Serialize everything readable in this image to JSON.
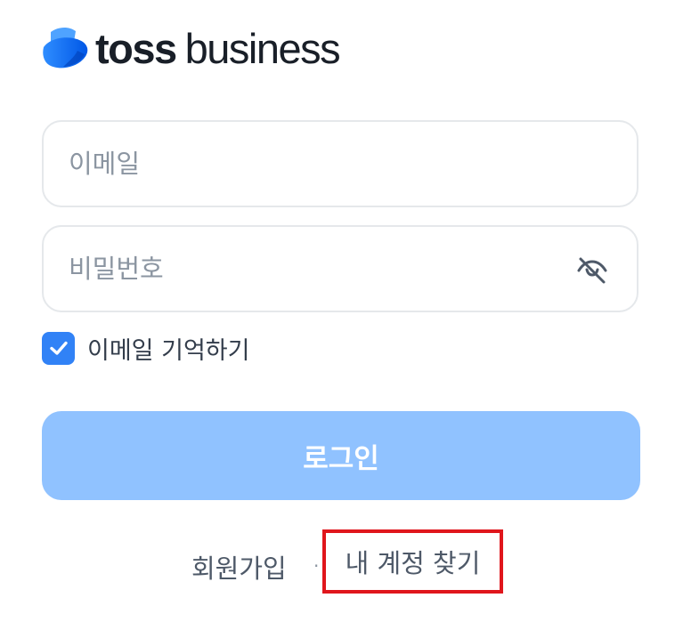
{
  "brand": {
    "logo_bold": "toss",
    "logo_light": "business"
  },
  "form": {
    "email": {
      "placeholder": "이메일",
      "value": ""
    },
    "password": {
      "placeholder": "비밀번호",
      "value": ""
    },
    "password_toggle_icon": "eye-off-icon",
    "remember": {
      "label": "이메일 기억하기",
      "checked": true
    },
    "login_label": "로그인"
  },
  "links": {
    "signup": "회원가입",
    "separator": "·",
    "find_account": "내 계정 찾기"
  },
  "colors": {
    "primary": "#3182f6",
    "button_disabled": "#90c2ff",
    "highlight_box": "#e0161c"
  }
}
